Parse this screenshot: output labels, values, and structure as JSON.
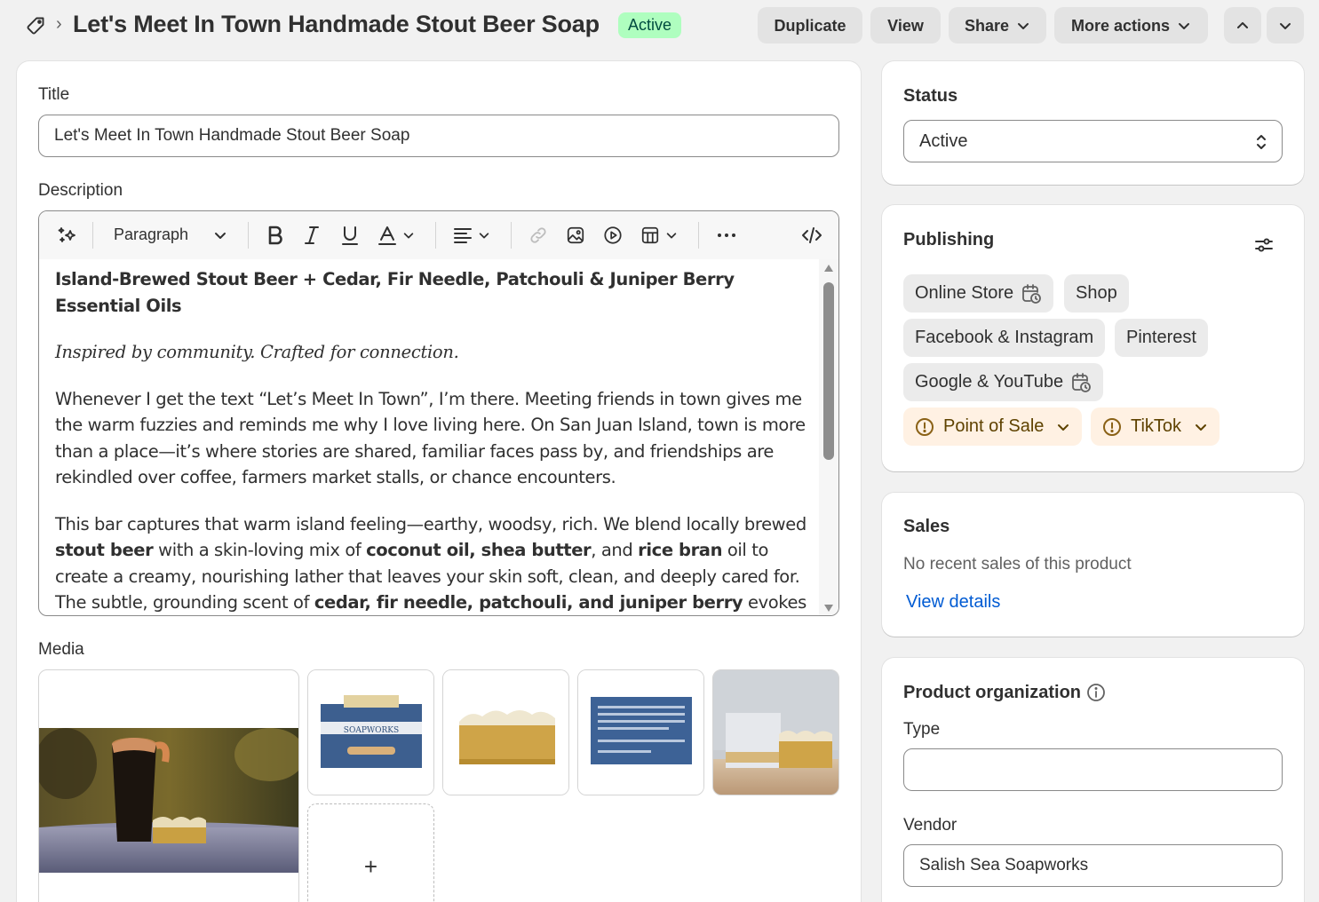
{
  "header": {
    "title": "Let's Meet In Town Handmade Stout Beer Soap",
    "status_badge": "Active",
    "buttons": {
      "duplicate": "Duplicate",
      "view": "View",
      "share": "Share",
      "more_actions": "More actions"
    }
  },
  "main": {
    "title_label": "Title",
    "title_value": "Let's Meet In Town Handmade Stout Beer Soap",
    "description_label": "Description",
    "toolbar": {
      "paragraph": "Paragraph"
    },
    "description": {
      "heading": "Island-Brewed Stout Beer + Cedar, Fir Needle, Patchouli & Juniper Berry Essential Oils",
      "tagline": "Inspired by community. Crafted for connection.",
      "p1": "Whenever I get the text “Let’s Meet In Town”, I’m there. Meeting friends in town gives me the warm fuzzies and reminds me why I love living here. On San Juan Island, town is more than a place—it’s where stories are shared, familiar faces pass by, and friendships are rekindled over coffee, farmers market stalls, or chance encounters.",
      "p2_a": "This bar captures that warm island feeling—earthy, woodsy, rich. We blend locally brewed ",
      "p2_b": "stout beer",
      "p2_c": " with a skin-loving mix of ",
      "p2_d": "coconut oil, shea butter",
      "p2_e": ", and ",
      "p2_f": "rice bran",
      "p2_g": " oil to create a creamy, nourishing lather that leaves your skin soft, clean, and deeply cared for. The subtle, grounding scent of ",
      "p2_h": "cedar, fir needle, patchouli, and juniper berry",
      "p2_i": " evokes the"
    },
    "media_label": "Media",
    "add_media": "+"
  },
  "sidebar": {
    "status": {
      "label": "Status",
      "value": "Active"
    },
    "publishing": {
      "label": "Publishing",
      "channels": {
        "online_store": "Online Store",
        "shop": "Shop",
        "facebook": "Facebook & Instagram",
        "pinterest": "Pinterest",
        "google": "Google & YouTube",
        "pos": "Point of Sale",
        "tiktok": "TikTok"
      }
    },
    "sales": {
      "label": "Sales",
      "text": "No recent sales of this product",
      "link": "View details"
    },
    "organization": {
      "label": "Product organization",
      "type_label": "Type",
      "type_value": "",
      "vendor_label": "Vendor",
      "vendor_value": "Salish Sea Soapworks"
    }
  },
  "colors": {
    "accent_link": "#005bd3",
    "badge_bg": "#affebf",
    "warning_bg": "#fff1e3"
  }
}
